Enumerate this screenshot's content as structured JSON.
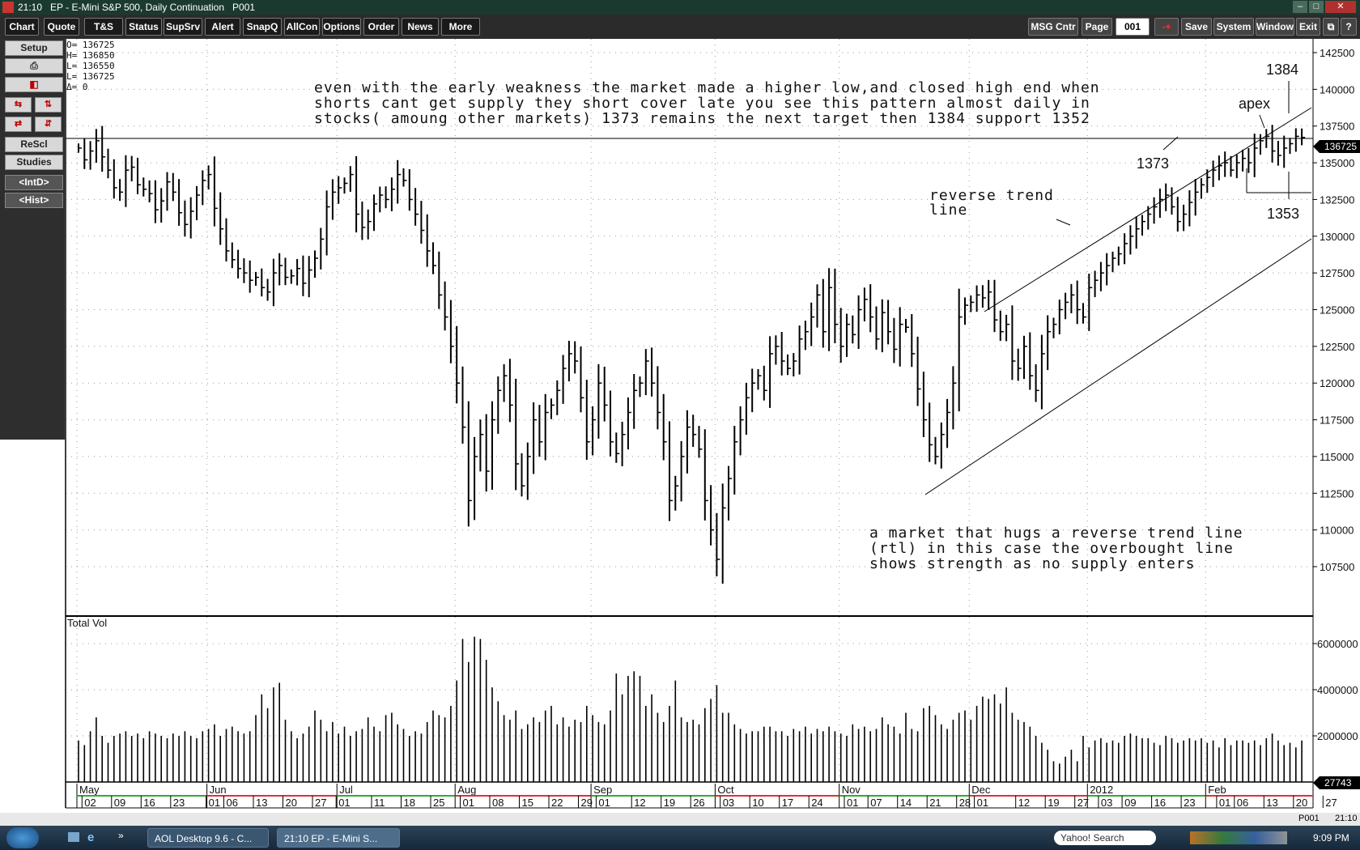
{
  "window": {
    "title": "21:10   EP - E-Mini S&P 500, Daily Continuation   P001"
  },
  "toolbar": {
    "left": [
      "Chart",
      "Quote",
      "T&S",
      "Status",
      "SupSrv",
      "Alert",
      "SnapQ",
      "AllCon",
      "Options",
      "Order",
      "News",
      "More"
    ],
    "msg": "MSG Cntr",
    "page_label": "Page",
    "page_value": "001",
    "right": [
      "Save",
      "System",
      "Window",
      "Exit"
    ]
  },
  "sidebar": {
    "buttons": [
      "Setup",
      "ReScl",
      "Studies",
      "<IntD>",
      "<Hist>"
    ]
  },
  "ohlc_box": {
    "o": "O= 136725",
    "h": "H= 136850",
    "l": "L= 136550",
    "last": "L= 136725",
    "d": "Δ=        0"
  },
  "chart_data": {
    "type": "bar",
    "title": "EP - E-Mini S&P 500, Daily Continuation",
    "price_axis": {
      "ticks": [
        "142500",
        "140000",
        "137500",
        "135000",
        "132500",
        "130000",
        "127500",
        "125000",
        "122500",
        "120000",
        "117500",
        "115000",
        "112500",
        "110000",
        "107500"
      ],
      "ylim": [
        106500,
        144000
      ],
      "current": "136725"
    },
    "volume_axis": {
      "label": "Total Vol",
      "ticks": [
        "6000000",
        "4000000",
        "2000000"
      ],
      "current": "27743"
    },
    "months": [
      {
        "label": "May",
        "day": 0
      },
      {
        "label": "Jun",
        "day": 22
      },
      {
        "label": "Jul",
        "day": 44
      },
      {
        "label": "Aug",
        "day": 64
      },
      {
        "label": "Sep",
        "day": 87
      },
      {
        "label": "Oct",
        "day": 108
      },
      {
        "label": "Nov",
        "day": 129
      },
      {
        "label": "Dec",
        "day": 151
      },
      {
        "label": "2012",
        "day": 171
      },
      {
        "label": "Feb",
        "day": 191
      }
    ],
    "day_ticks": [
      {
        "label": "02",
        "day": 1
      },
      {
        "label": "09",
        "day": 6
      },
      {
        "label": "16",
        "day": 11
      },
      {
        "label": "23",
        "day": 16
      },
      {
        "label": "01",
        "day": 22
      },
      {
        "label": "06",
        "day": 25
      },
      {
        "label": "13",
        "day": 30
      },
      {
        "label": "20",
        "day": 35
      },
      {
        "label": "27",
        "day": 40
      },
      {
        "label": "01",
        "day": 44
      },
      {
        "label": "11",
        "day": 50
      },
      {
        "label": "18",
        "day": 55
      },
      {
        "label": "25",
        "day": 60
      },
      {
        "label": "01",
        "day": 65
      },
      {
        "label": "08",
        "day": 70
      },
      {
        "label": "15",
        "day": 75
      },
      {
        "label": "22",
        "day": 80
      },
      {
        "label": "29",
        "day": 85
      },
      {
        "label": "01",
        "day": 88
      },
      {
        "label": "12",
        "day": 94
      },
      {
        "label": "19",
        "day": 99
      },
      {
        "label": "26",
        "day": 104
      },
      {
        "label": "03",
        "day": 109
      },
      {
        "label": "10",
        "day": 114
      },
      {
        "label": "17",
        "day": 119
      },
      {
        "label": "24",
        "day": 124
      },
      {
        "label": "01",
        "day": 130
      },
      {
        "label": "07",
        "day": 134
      },
      {
        "label": "14",
        "day": 139
      },
      {
        "label": "21",
        "day": 144
      },
      {
        "label": "28",
        "day": 149
      },
      {
        "label": "01",
        "day": 152
      },
      {
        "label": "12",
        "day": 159
      },
      {
        "label": "19",
        "day": 164
      },
      {
        "label": "27",
        "day": 169
      },
      {
        "label": "03",
        "day": 173
      },
      {
        "label": "09",
        "day": 177
      },
      {
        "label": "16",
        "day": 182
      },
      {
        "label": "23",
        "day": 187
      },
      {
        "label": "01",
        "day": 193
      },
      {
        "label": "06",
        "day": 196
      },
      {
        "label": "13",
        "day": 201
      },
      {
        "label": "20",
        "day": 206
      },
      {
        "label": "27",
        "day": 211
      }
    ],
    "closes": [
      136000,
      135200,
      135800,
      136500,
      135400,
      134500,
      133300,
      133000,
      134500,
      134700,
      133500,
      133200,
      132900,
      131800,
      132400,
      133700,
      133000,
      131600,
      130800,
      131700,
      132800,
      133800,
      134200,
      131900,
      130500,
      129000,
      128400,
      127800,
      127500,
      127000,
      127200,
      126500,
      126200,
      127500,
      128000,
      127200,
      127300,
      127800,
      126800,
      127700,
      128500,
      129800,
      132000,
      133000,
      133300,
      133600,
      134200,
      131500,
      130600,
      131000,
      132200,
      132800,
      132500,
      133200,
      134200,
      133800,
      132500,
      131500,
      130400,
      129000,
      128000,
      126000,
      124500,
      122500,
      120000,
      117000,
      112000,
      115000,
      116500,
      114000,
      117500,
      119500,
      120500,
      118500,
      114500,
      113000,
      115000,
      117500,
      116000,
      118000,
      118500,
      119500,
      121000,
      122000,
      121500,
      119000,
      116000,
      117500,
      120000,
      118500,
      116000,
      115200,
      116500,
      118000,
      119500,
      120000,
      121500,
      120000,
      118000,
      116000,
      112000,
      113000,
      115000,
      117000,
      116500,
      115500,
      112000,
      110000,
      108000,
      111500,
      113500,
      116000,
      117500,
      119000,
      120000,
      120500,
      119500,
      122000,
      122500,
      121500,
      121000,
      121500,
      123000,
      123500,
      124500,
      126000,
      123500,
      126500,
      124000,
      122500,
      124000,
      123300,
      125000,
      125700,
      124500,
      123000,
      124800,
      123500,
      122300,
      124000,
      123800,
      122000,
      119600,
      117500,
      115800,
      115000,
      116500,
      118000,
      120000,
      124500,
      125300,
      125500,
      126000,
      125800,
      126200,
      124300,
      123500,
      124000,
      121500,
      121000,
      122500,
      120500,
      119500,
      122000,
      123500,
      124000,
      125000,
      125500,
      126000,
      125000,
      124500,
      126500,
      127000,
      127500,
      128000,
      128500,
      128800,
      129500,
      130000,
      130500,
      131000,
      131500,
      132000,
      132500,
      132800,
      132000,
      131000,
      131500,
      132300,
      133000,
      133500,
      134000,
      134500,
      134800,
      135000,
      134500,
      135000,
      135300,
      135000,
      136000,
      136500,
      136800,
      135800,
      135500,
      136000,
      136300,
      136800,
      136725
    ],
    "volumes": [
      1800000,
      1600000,
      2200000,
      2800000,
      2000000,
      1700000,
      2000000,
      2100000,
      2200000,
      2000000,
      2100000,
      1900000,
      2200000,
      2100000,
      2000000,
      1900000,
      2100000,
      2000000,
      2200000,
      2000000,
      1900000,
      2200000,
      2300000,
      2500000,
      2000000,
      2300000,
      2400000,
      2200000,
      2100000,
      2200000,
      2900000,
      3800000,
      3200000,
      4100000,
      4300000,
      2700000,
      2200000,
      1900000,
      2100000,
      2400000,
      3100000,
      2700000,
      2200000,
      2600000,
      2100000,
      2400000,
      2000000,
      2200000,
      2300000,
      2800000,
      2400000,
      2200000,
      2900000,
      3000000,
      2500000,
      2300000,
      2000000,
      2200000,
      2100000,
      2600000,
      3100000,
      2900000,
      2800000,
      3300000,
      4400000,
      6200000,
      5200000,
      6300000,
      6200000,
      5300000,
      4100000,
      3500000,
      2900000,
      2700000,
      3100000,
      2300000,
      2500000,
      2800000,
      2600000,
      3100000,
      3300000,
      2500000,
      2800000,
      2400000,
      2700000,
      2600000,
      3300000,
      2900000,
      2600000,
      2500000,
      3100000,
      4700000,
      3800000,
      4600000,
      4800000,
      4600000,
      3300000,
      3800000,
      3000000,
      2600000,
      3300000,
      4400000,
      2800000,
      2600000,
      2700000,
      2500000,
      3200000,
      3600000,
      4200000,
      3000000,
      3000000,
      2500000,
      2300000,
      2100000,
      2200000,
      2200000,
      2400000,
      2400000,
      2200000,
      2200000,
      2000000,
      2300000,
      2200000,
      2400000,
      2100000,
      2300000,
      2200000,
      2400000,
      2200000,
      2100000,
      2000000,
      2500000,
      2300000,
      2400000,
      2200000,
      2300000,
      2800000,
      2500000,
      2400000,
      2100000,
      3000000,
      2300000,
      2200000,
      3200000,
      3300000,
      2900000,
      2500000,
      2300000,
      2700000,
      3000000,
      3100000,
      2700000,
      3300000,
      3700000,
      3600000,
      3800000,
      3400000,
      4100000,
      3000000,
      2700000,
      2600000,
      2400000,
      2000000,
      1700000,
      1400000,
      900000,
      800000,
      1100000,
      1400000,
      900000,
      2000000,
      1500000,
      1800000,
      1900000,
      1700000,
      1800000,
      1700000,
      2000000,
      2100000,
      2000000,
      1900000,
      1900000,
      1700000,
      1600000,
      2000000,
      1900000,
      1700000,
      1800000,
      1900000,
      1800000,
      1900000,
      1700000,
      1800000,
      1500000,
      1900000,
      1600000,
      1800000,
      1800000,
      1700000,
      1800000,
      1600000,
      1900000,
      2100000,
      1800000,
      1600000,
      1700000,
      1500000,
      1800000
    ],
    "annotations": {
      "commentary": [
        "even with the early weakness the market made a higher low,and closed high end when",
        "shorts cant get supply they short cover late you see this pattern almost daily in",
        "stocks( amoung other markets) 1373 remains the next target then 1384 support 1352"
      ],
      "rtl_label": [
        "reverse trend",
        "line"
      ],
      "note": [
        "a market that hugs a reverse trend line",
        "(rtl) in this case the overbought line",
        "shows strength as no supply enters"
      ],
      "level_1373": "1373",
      "level_1384": "1384",
      "level_1353": "1353",
      "apex": "apex"
    }
  },
  "statusbar": {
    "page": "P001",
    "time": "21:10"
  },
  "taskbar": {
    "task1": "AOL Desktop 9.6 - C...",
    "task2": "21:10   EP - E-Mini S...",
    "search": "Yahoo! Search",
    "clock": "9:09 PM"
  }
}
